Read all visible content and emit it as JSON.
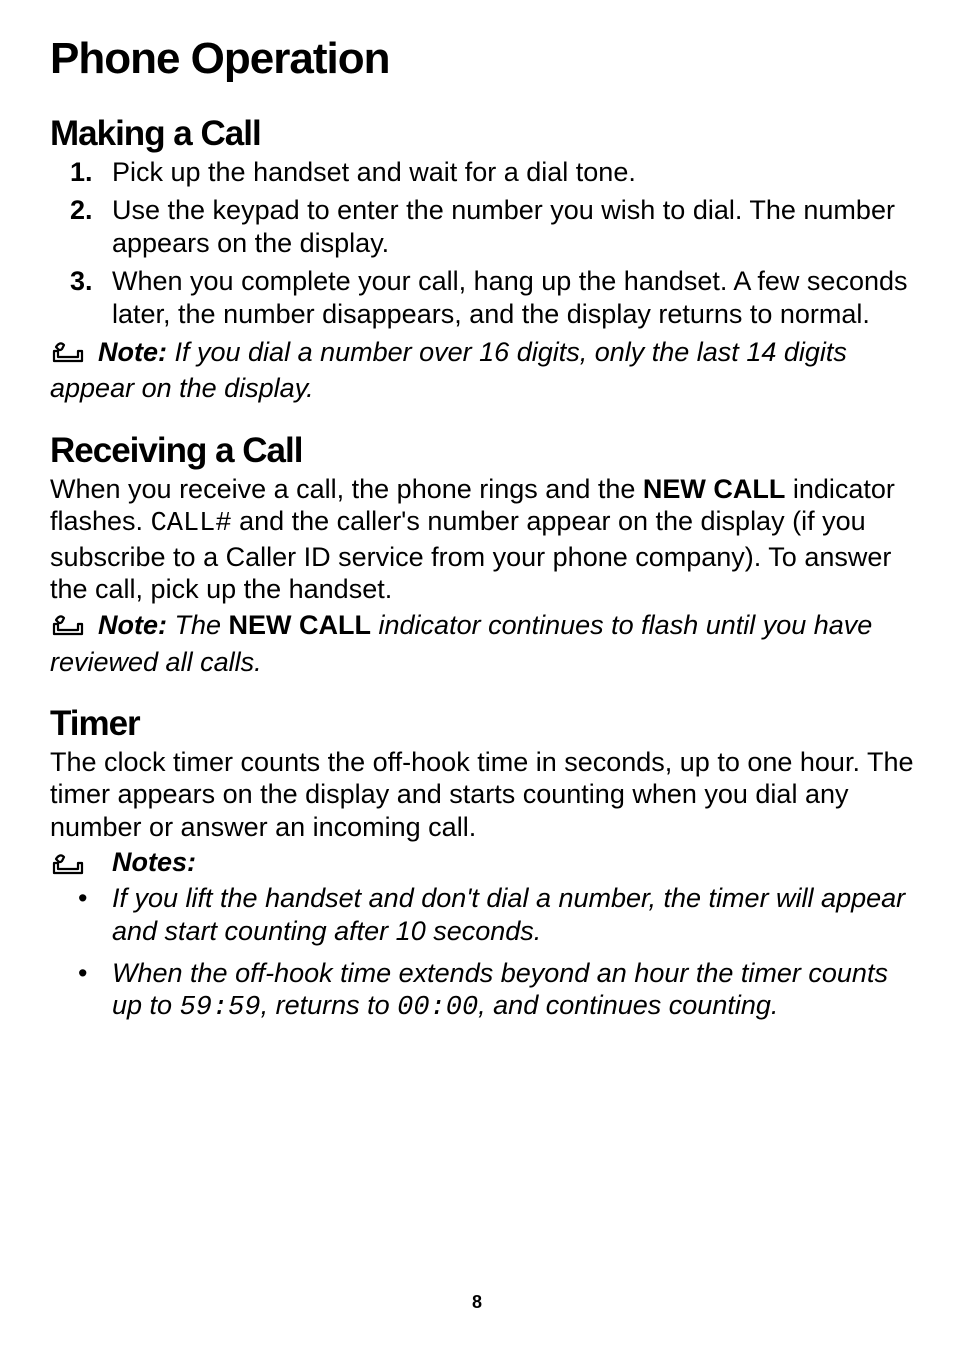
{
  "page_title": "Phone Operation",
  "page_number": "8",
  "sections": {
    "making_call": {
      "heading": "Making a Call",
      "steps": [
        "Pick up the handset and wait for a dial tone.",
        "Use the keypad to enter the number you wish to dial. The number appears on the display.",
        "When you complete your call, hang up the handset. A few seconds later, the number disappears, and the display returns to normal."
      ],
      "note_label": "Note:",
      "note_text": " If you dial a number over 16 digits, only the last 14 digits appear on the display."
    },
    "receiving_call": {
      "heading": "Receiving a Call",
      "body_pre": "When you receive a call, the phone rings and the ",
      "body_bold1": "NEW CALL",
      "body_mid1": " indicator flashes. ",
      "body_seg": "CALL#",
      "body_post": " and the caller's number appear on the display (if you subscribe to a Caller ID service from your phone company). To answer the call, pick up the handset.",
      "note_label": "Note:",
      "note_pre": " The ",
      "note_bold": "NEW CALL",
      "note_post": " indicator continues to flash until you have reviewed all calls."
    },
    "timer": {
      "heading": "Timer",
      "body": "The clock timer counts the off-hook time in seconds, up to one hour. The timer appears on the display and starts counting when you dial any number or answer an incoming call.",
      "notes_label": "Notes:",
      "bullet1": "If you lift the handset and don't dial a number, the timer will appear and start counting after 10 seconds.",
      "bullet2_pre": "When the off-hook time extends beyond an hour the timer counts up to ",
      "bullet2_seg1": "59:59",
      "bullet2_mid": ", returns to ",
      "bullet2_seg2": "00:00",
      "bullet2_post": ", and continues counting."
    }
  }
}
